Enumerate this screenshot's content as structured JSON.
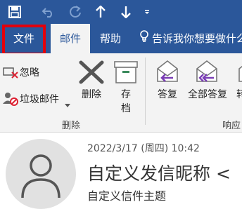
{
  "quick_access": {
    "icons": [
      "save-icon",
      "undo-icon",
      "redo-icon",
      "up-arrow-icon",
      "down-arrow-icon",
      "customize-dropdown-icon"
    ]
  },
  "tabs": {
    "file": "文件",
    "mail": "邮件",
    "help": "帮助",
    "tell_me": "告诉我你想要做什么"
  },
  "ribbon": {
    "ignore": "忽略",
    "junk": "垃圾邮件",
    "delete_label": "删除",
    "archive_line1": "存",
    "archive_line2": "档",
    "delete_group": "删除",
    "reply": "答复",
    "reply_all": "全部答复",
    "respond_group": "响应",
    "forward_partial": "转"
  },
  "message": {
    "date": "2022/3/17 (周四) 10:42",
    "sender": "自定义发信昵称 <",
    "subject": "自定义信件主题"
  },
  "colors": {
    "accent": "#2b579a",
    "highlight_box": "#e3000b",
    "reply_arrow": "#7b3fb5"
  }
}
